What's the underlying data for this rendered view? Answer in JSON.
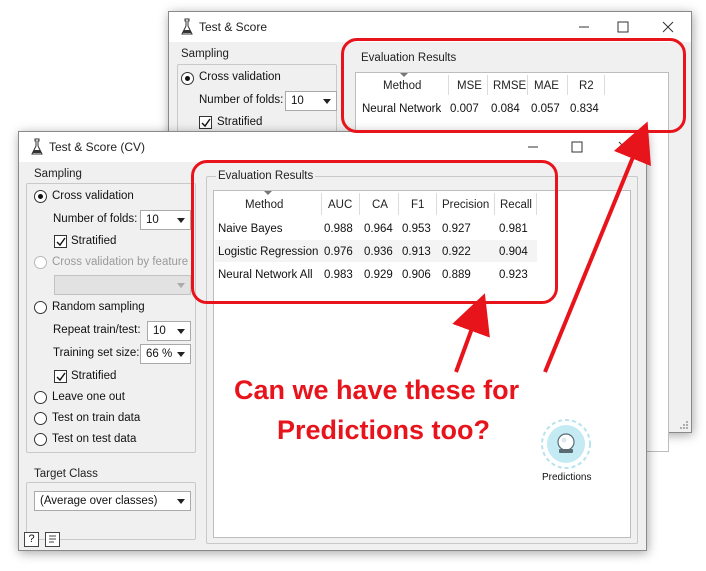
{
  "back_window": {
    "title": "Test & Score",
    "sampling": {
      "title": "Sampling",
      "cross_validation": "Cross validation",
      "folds_label": "Number of folds:",
      "folds_value": "10",
      "stratified": "Stratified"
    },
    "results": {
      "title": "Evaluation Results",
      "columns": [
        "Method",
        "MSE",
        "RMSE",
        "MAE",
        "R2"
      ],
      "rows": [
        [
          "Neural Network",
          "0.007",
          "0.084",
          "0.057",
          "0.834"
        ]
      ]
    }
  },
  "front_window": {
    "title": "Test & Score (CV)",
    "sampling": {
      "title": "Sampling",
      "cross_validation": "Cross validation",
      "folds_label": "Number of folds:",
      "folds_value": "10",
      "stratified": "Stratified",
      "cv_by_feature": "Cross validation by feature",
      "random_sampling": "Random sampling",
      "repeat_label": "Repeat train/test:",
      "repeat_value": "10",
      "train_size_label": "Training set size:",
      "train_size_value": "66 %",
      "stratified2": "Stratified",
      "leave_one_out": "Leave one out",
      "test_on_train": "Test on train data",
      "test_on_test": "Test on test data"
    },
    "target": {
      "title": "Target Class",
      "value": "(Average over classes)"
    },
    "results": {
      "title": "Evaluation Results",
      "columns": [
        "Method",
        "AUC",
        "CA",
        "F1",
        "Precision",
        "Recall"
      ],
      "rows": [
        [
          "Naive Bayes",
          "0.988",
          "0.964",
          "0.953",
          "0.927",
          "0.981"
        ],
        [
          "Logistic Regression",
          "0.976",
          "0.936",
          "0.913",
          "0.922",
          "0.904"
        ],
        [
          "Neural Network All",
          "0.983",
          "0.929",
          "0.906",
          "0.889",
          "0.923"
        ]
      ]
    }
  },
  "annotation": {
    "line1": "Can we have these for",
    "line2": "Predictions too?",
    "color": "#e8141c"
  },
  "predictions_widget": {
    "label": "Predictions",
    "icon": "predictions-icon"
  }
}
